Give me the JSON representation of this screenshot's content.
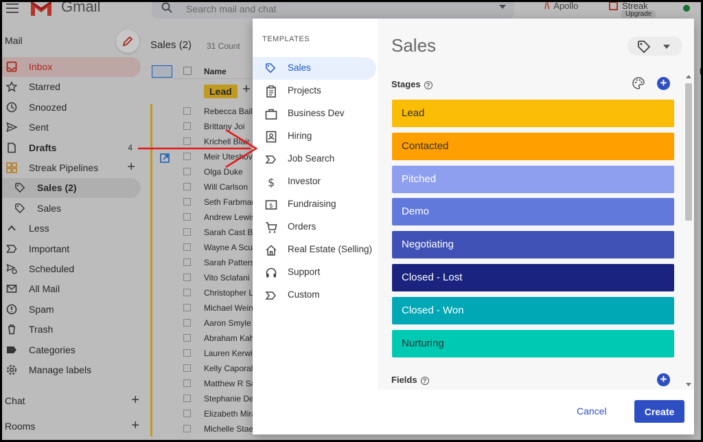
{
  "app": {
    "title": "Gmail",
    "search_placeholder": "Search mail and chat",
    "apollo_label": "Apollo",
    "streak_label": "Streak",
    "upgrade_label": "Upgrade"
  },
  "sidebar": {
    "section_label": "Mail",
    "items": [
      {
        "label": "Inbox",
        "icon": "inbox-icon",
        "active": true
      },
      {
        "label": "Starred",
        "icon": "star-icon"
      },
      {
        "label": "Snoozed",
        "icon": "clock-icon"
      },
      {
        "label": "Sent",
        "icon": "send-icon"
      },
      {
        "label": "Drafts",
        "icon": "draft-icon",
        "count": "4",
        "bold": true
      },
      {
        "label": "Streak Pipelines",
        "icon": "grid-icon",
        "plus": "+"
      },
      {
        "label": "Sales (2)",
        "icon": "tag-icon",
        "sub": true,
        "bold": true
      },
      {
        "label": "Sales",
        "icon": "tag-icon"
      },
      {
        "label": "Less",
        "icon": "chevron-up-icon"
      },
      {
        "label": "Important",
        "icon": "important-icon"
      },
      {
        "label": "Scheduled",
        "icon": "scheduled-icon"
      },
      {
        "label": "All Mail",
        "icon": "mail-icon"
      },
      {
        "label": "Spam",
        "icon": "spam-icon"
      },
      {
        "label": "Trash",
        "icon": "trash-icon"
      },
      {
        "label": "Categories",
        "icon": "label-icon"
      },
      {
        "label": "Manage labels",
        "icon": "gear-icon"
      }
    ],
    "chat_label": "Chat",
    "rooms_label": "Rooms"
  },
  "list": {
    "title": "Sales (2)",
    "count_label": "31 Count",
    "name_header": "Name",
    "le_header": "Le",
    "lead_badge": "Lead",
    "names": [
      "Rebecca Baile",
      "Brittany Joi",
      "Krichell Blair",
      "Meir Uteshov",
      "Olga Duke",
      "Will Carlson",
      "Seth Farbman",
      "Andrew Lewis",
      "Sarah Cast B",
      "Wayne A Scu",
      "Sarah Patters",
      "Vito Sclafani",
      "Christopher L",
      "Michael Wein",
      "Aaron Smyle",
      "Abraham Kah",
      "Lauren Kerwi",
      "Kelly Caporal",
      "Matthew R Sa",
      "Stephanie De",
      "Elizabeth Mira",
      "Michelle Staec"
    ]
  },
  "modal": {
    "templates_heading": "TEMPLATES",
    "templates": [
      {
        "label": "Sales",
        "icon": "tag-icon",
        "active": true
      },
      {
        "label": "Projects",
        "icon": "clipboard-icon"
      },
      {
        "label": "Business Dev",
        "icon": "briefcase-icon"
      },
      {
        "label": "Hiring",
        "icon": "id-badge-icon"
      },
      {
        "label": "Job Search",
        "icon": "chevron-tag-icon"
      },
      {
        "label": "Investor",
        "icon": "dollar-icon"
      },
      {
        "label": "Fundraising",
        "icon": "money-icon"
      },
      {
        "label": "Orders",
        "icon": "cart-icon"
      },
      {
        "label": "Real Estate (Selling)",
        "icon": "house-icon"
      },
      {
        "label": "Support",
        "icon": "headset-icon"
      },
      {
        "label": "Custom",
        "icon": "chevron-tag-icon"
      }
    ],
    "pipeline_title": "Sales",
    "stages_label": "Stages",
    "help_glyph": "?",
    "stages": [
      {
        "label": "Lead",
        "color": "#fbbc04",
        "text_color": "#333333"
      },
      {
        "label": "Contacted",
        "color": "#ff9f00",
        "text_color": "#333333"
      },
      {
        "label": "Pitched",
        "color": "#8e9ff0",
        "text_color": "#ffffff"
      },
      {
        "label": "Demo",
        "color": "#6079da",
        "text_color": "#ffffff"
      },
      {
        "label": "Negotiating",
        "color": "#3f51b5",
        "text_color": "#ffffff"
      },
      {
        "label": "Closed - Lost",
        "color": "#1a237e",
        "text_color": "#ffffff"
      },
      {
        "label": "Closed - Won",
        "color": "#00a7b5",
        "text_color": "#ffffff"
      },
      {
        "label": "Nurturing",
        "color": "#00c9b2",
        "text_color": "#333333"
      }
    ],
    "fields_label": "Fields",
    "add_glyph": "+",
    "cancel_label": "Cancel",
    "create_label": "Create"
  }
}
